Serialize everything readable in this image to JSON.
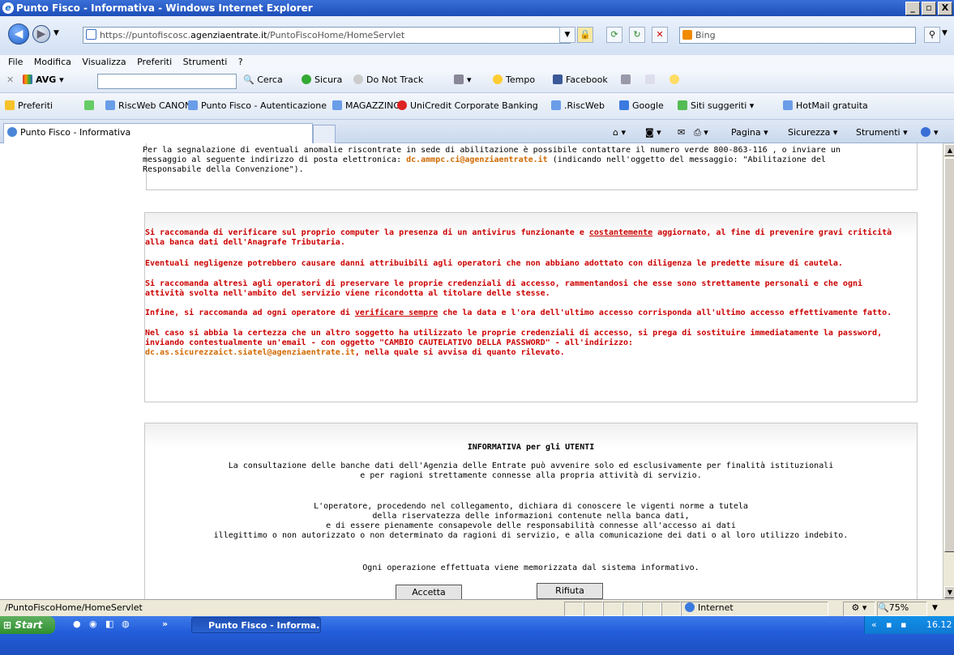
{
  "window": {
    "title": "Punto Fisco - Informativa - Windows Internet Explorer",
    "min": "_",
    "max": "8",
    "close": "X"
  },
  "address": {
    "scheme": "https://",
    "domain_pre": "puntofiscosc.",
    "domain": "agenziaentrate.it",
    "path": "/PuntoFiscoHome/HomeServlet",
    "search_placeholder": "Bing"
  },
  "menu": [
    "File",
    "Modifica",
    "Visualizza",
    "Preferiti",
    "Strumenti",
    "?"
  ],
  "toolbar": {
    "avg": "AVG",
    "cerca": "Cerca",
    "sicura": "Sicura",
    "dnt": "Do Not Track",
    "tempo": "Tempo",
    "facebook": "Facebook"
  },
  "favorites": {
    "label": "Preferiti",
    "items": [
      "RiscWeb CANONI",
      "Punto Fisco - Autenticazione",
      "MAGAZZINO",
      "UniCredit Corporate Banking",
      ".RiscWeb",
      "Google",
      "Siti suggeriti",
      "HotMail gratuita"
    ]
  },
  "tab": {
    "label": "Punto Fisco - Informativa"
  },
  "commandbar": {
    "pagina": "Pagina",
    "sicurezza": "Sicurezza",
    "strumenti": "Strumenti"
  },
  "content": {
    "box1": {
      "line1": "Per la segnalazione di eventuali anomalie riscontrate in sede di abilitazione è possibile contattare il numero verde 800-863-116 , o inviare un",
      "line2_pre": "messaggio al seguente indirizzo di posta elettronica: ",
      "line2_email": "dc.ammpc.ci@agenziaentrate.it",
      "line2_post": " (indicando nell'oggetto del messaggio: \"Abilitazione del",
      "line3": "Responsabile della Convenzione\")."
    },
    "box2": {
      "p1a_pre": "Si raccomanda di verificare sul proprio computer la presenza di un antivirus funzionante e ",
      "p1a_u": "costantemente",
      "p1a_post": " aggiornato, al fine di prevenire gravi criticità",
      "p1b": "alla banca dati dell'Anagrafe Tributaria.",
      "p2": "Eventuali negligenze potrebbero causare danni attribuibili agli operatori che non abbiano adottato con diligenza le predette misure di cautela.",
      "p3a": "Si raccomanda altresì agli operatori di preservare le proprie credenziali di accesso, rammentandosi che esse sono strettamente personali e che ogni",
      "p3b": "attività svolta nell'ambito del servizio viene ricondotta al titolare delle stesse.",
      "p4_pre": "Infine, si raccomanda ad ogni operatore di ",
      "p4_u": "verificare sempre",
      "p4_post": " che la data e l'ora dell'ultimo accesso corrisponda all'ultimo accesso effettivamente fatto.",
      "p5a": "Nel caso si abbia la certezza che un altro soggetto ha utilizzato le proprie credenziali di accesso, si prega di sostituire immediatamente la password,",
      "p5b": "inviando contestualmente un'email - con oggetto \"CAMBIO CAUTELATIVO DELLA PASSWORD\" - all'indirizzo:",
      "p5c_email": "dc.as.sicurezzaict.siatel@agenziaentrate.it",
      "p5c_post": ", nella quale si avvisa di quanto rilevato."
    },
    "box3": {
      "heading": "INFORMATIVA per gli UTENTI",
      "a1": "La consultazione delle banche dati dell'Agenzia delle Entrate può avvenire solo ed esclusivamente per finalità istituzionali",
      "a2": "e per ragioni strettamente connesse alla propria attività di servizio.",
      "b1": "L'operatore, procedendo nel collegamento, dichiara di conoscere le vigenti norme a tutela",
      "b2": "della riservatezza delle informazioni contenute nella banca dati,",
      "b3": "e di essere pienamente consapevole delle responsabilità connesse all'accesso ai dati",
      "b4": "illegittimo o non autorizzato o non determinato da ragioni di servizio, e alla comunicazione dei dati o al loro utilizzo indebito.",
      "c1": "Ogni operazione effettuata viene memorizzata dal sistema informativo."
    },
    "accept_label": "Accetta",
    "reject_label": "Rifiuta"
  },
  "status": {
    "url": "/PuntoFiscoHome/HomeServlet",
    "zone": "Internet",
    "zoom": "75%"
  },
  "taskbar": {
    "start": "Start",
    "item": "Punto Fisco - Informa...",
    "time": "16.12"
  }
}
